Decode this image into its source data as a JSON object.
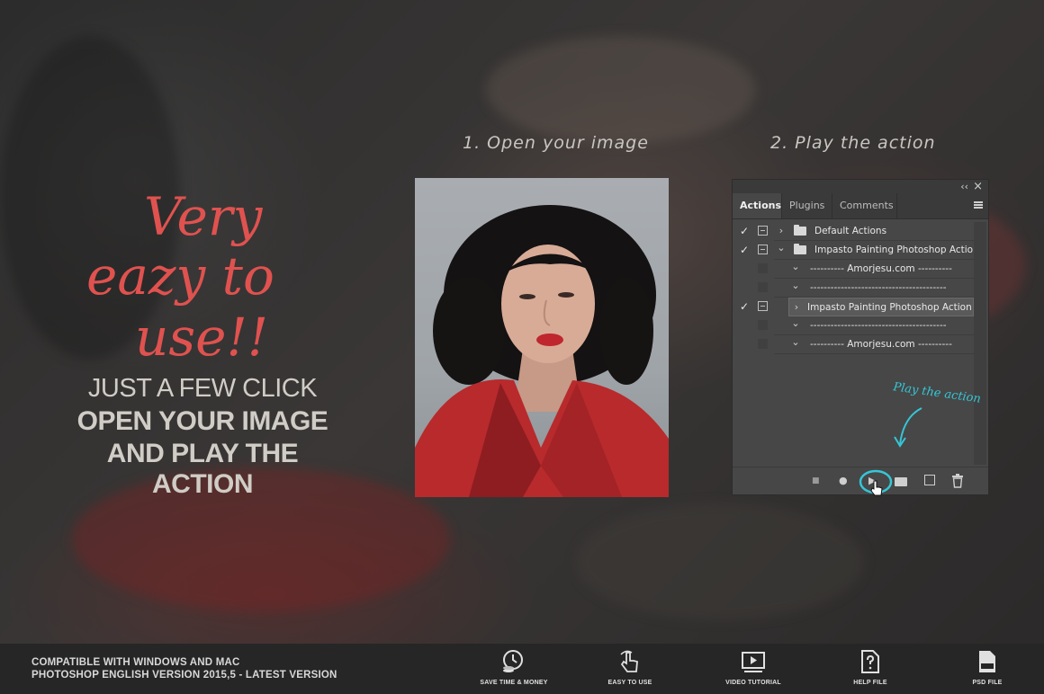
{
  "headline": {
    "line1": "Very",
    "line2": "eazy to",
    "line3": "use!!",
    "sub1": "JUST A FEW CLICK",
    "sub2": "OPEN YOUR IMAGE",
    "sub3": "AND PLAY THE ACTION"
  },
  "steps": {
    "step1": "1. Open your image",
    "step2": "2. Play the action"
  },
  "panel": {
    "collapse": "‹‹",
    "close": "×",
    "tabs": [
      "Actions",
      "Plugins",
      "Comments"
    ],
    "rows": [
      {
        "check": "✓",
        "arrow": "›",
        "text": "Default Actions"
      },
      {
        "check": "✓",
        "arrow": "⌄",
        "text": "Impasto Painting Photoshop Action"
      },
      {
        "check": "",
        "arrow": "⌄",
        "text": "---------- Amorjesu.com ----------"
      },
      {
        "check": "",
        "arrow": "⌄",
        "text": "----------------------------------------"
      },
      {
        "check": "✓",
        "arrow": "›",
        "text": "Impasto Painting Photoshop Action"
      },
      {
        "check": "",
        "arrow": "⌄",
        "text": "----------------------------------------"
      },
      {
        "check": "",
        "arrow": "⌄",
        "text": "---------- Amorjesu.com ----------"
      }
    ],
    "annotation": "Play the action",
    "bottom": {
      "stop": "■",
      "record": "●",
      "play": "▶"
    }
  },
  "footer": {
    "compat1": "COMPATIBLE WITH WINDOWS AND MAC",
    "compat2": "PHOTOSHOP ENGLISH VERSION 2015,5 - LATEST VERSION",
    "features": [
      {
        "label": "SAVE TIME & MONEY",
        "icon": "clock-coins-icon"
      },
      {
        "label": "EASY TO USE",
        "icon": "hand-tap-icon"
      },
      {
        "label": "VIDEO TUTORIAL",
        "icon": "video-icon"
      },
      {
        "label": "HELP FILE",
        "icon": "help-file-icon"
      },
      {
        "label": "PSD FILE",
        "icon": "psd-file-icon"
      }
    ]
  },
  "colors": {
    "accent": "#e0524f",
    "annotation": "#35c6d6"
  }
}
